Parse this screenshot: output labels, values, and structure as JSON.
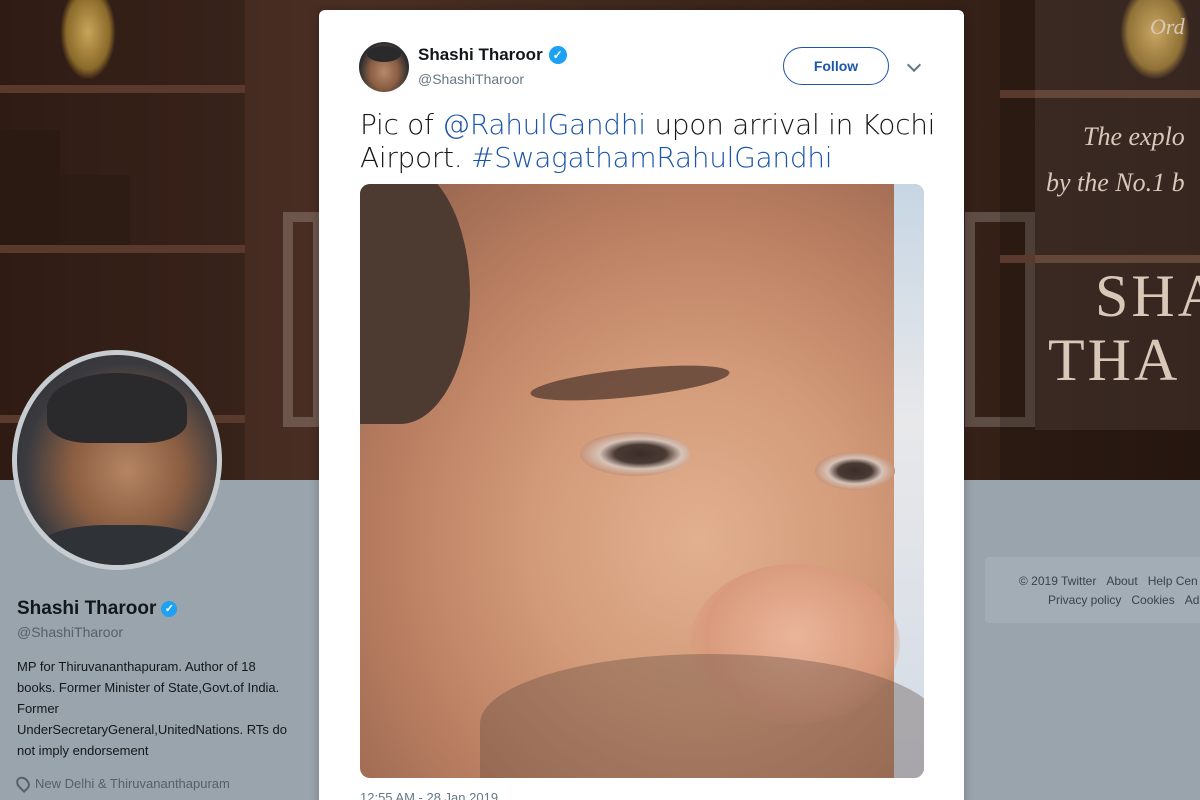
{
  "profile": {
    "name": "Shashi Tharoor",
    "handle": "@ShashiTharoor",
    "bio_lines": [
      "MP for Thiruvananthapuram. Author of 18",
      "books. Former Minister of State,Govt.of India.",
      "Former",
      "UnderSecretaryGeneral,UnitedNations. RTs do",
      "not imply endorsement"
    ],
    "location": "New Delhi & Thiruvananthapuram"
  },
  "banner": {
    "cover_line1": "The explo",
    "cover_line2": "by the No.1 b",
    "cover_big1": "SHA",
    "cover_big2": "THA",
    "cover_corner": "Ord"
  },
  "footer": {
    "row1": [
      "© 2019 Twitter",
      "About",
      "Help Cen"
    ],
    "row2": [
      "Privacy policy",
      "Cookies",
      "Ad"
    ]
  },
  "tweet": {
    "author_name": "Shashi Tharoor",
    "author_handle": "@ShashiTharoor",
    "follow_label": "Follow",
    "text_before": "Pic of ",
    "mention": "@RahulGandhi",
    "text_middle": " upon arrival in Kochi Airport. ",
    "hashtag": "#SwagathamRahulGandhi",
    "timestamp": "12:55 AM - 28 Jan 2019"
  },
  "icons": {
    "verified": "verified-badge-icon",
    "more": "chevron-down-icon",
    "location": "location-pin-icon"
  },
  "colors": {
    "link": "#1c56a8",
    "verified": "#1da1f2"
  }
}
